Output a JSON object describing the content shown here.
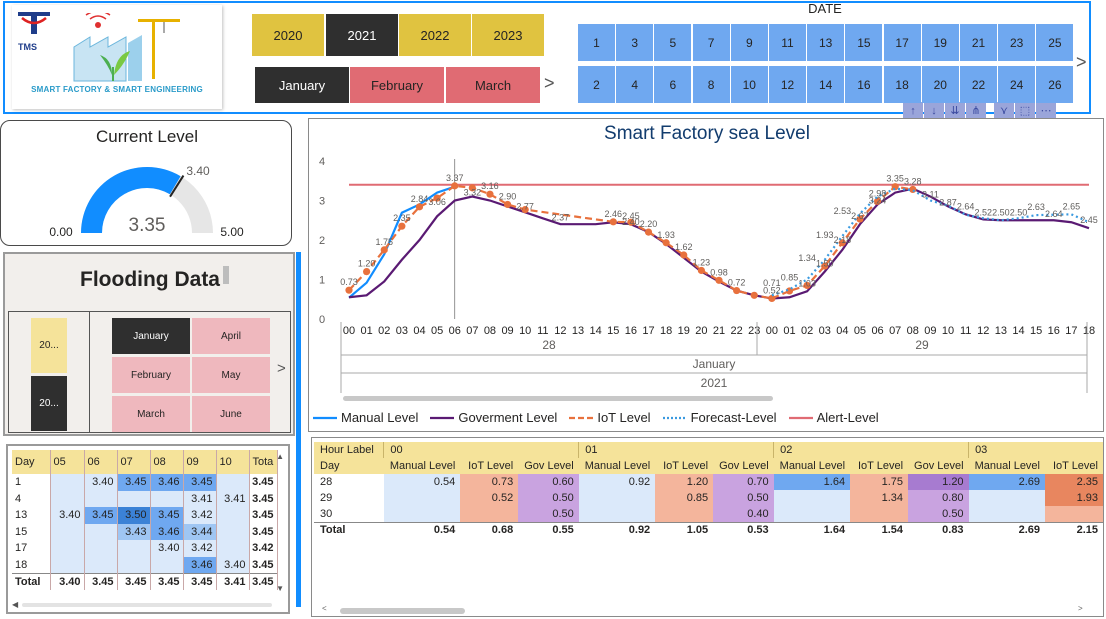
{
  "logo": {
    "tms_text": "TMS",
    "caption": "SMART FACTORY & SMART ENGINEERING"
  },
  "year_slicer": {
    "items": [
      "2020",
      "2021",
      "2022",
      "2023"
    ],
    "selected": "2021"
  },
  "month_slicer": {
    "items": [
      "January",
      "February",
      "March"
    ],
    "selected": "January",
    "next_arrow": ">"
  },
  "date_slicer": {
    "title": "DATE",
    "row1": [
      "1",
      "3",
      "5",
      "7",
      "9",
      "11",
      "13",
      "15",
      "17",
      "19",
      "21",
      "23",
      "25"
    ],
    "row2": [
      "2",
      "4",
      "6",
      "8",
      "10",
      "12",
      "14",
      "16",
      "18",
      "20",
      "22",
      "24",
      "26"
    ],
    "next_arrow": ">"
  },
  "toolbar_icons": [
    "drill-up-icon",
    "drill-down-icon",
    "expand-next-level-icon",
    "expand-all-icon",
    "filter-icon",
    "focus-mode-icon",
    "more-options-icon"
  ],
  "gauge": {
    "title": "Current Level",
    "value": 3.35,
    "value_text": "3.35",
    "min_text": "0.00",
    "max_text": "5.00",
    "target_text": "3.40",
    "min": 0,
    "max": 5,
    "target": 3.4,
    "colors": {
      "fill": "#118dff",
      "track": "#e6e6e6",
      "target": "#252423"
    }
  },
  "flooding": {
    "title": "Flooding Data",
    "years": [
      "20...",
      "20..."
    ],
    "months": [
      "January",
      "April",
      "February",
      "May",
      "March",
      "June"
    ],
    "selected_month": "January",
    "next_arrow": ">"
  },
  "flood_matrix": {
    "headers": [
      "Day",
      "05",
      "06",
      "07",
      "08",
      "09",
      "10",
      "Tota"
    ],
    "rows": [
      [
        "1",
        "",
        "3.40",
        "3.45",
        "3.46",
        "3.45",
        "",
        "3.45"
      ],
      [
        "4",
        "",
        "",
        "",
        "",
        "3.41",
        "3.41",
        "3.45"
      ],
      [
        "13",
        "3.40",
        "3.45",
        "3.50",
        "3.45",
        "3.42",
        "",
        "3.45"
      ],
      [
        "15",
        "",
        "",
        "3.43",
        "3.46",
        "3.44",
        "",
        "3.45"
      ],
      [
        "17",
        "",
        "",
        "",
        "3.40",
        "3.42",
        "",
        "3.42"
      ],
      [
        "18",
        "",
        "",
        "",
        "",
        "3.46",
        "3.40",
        "3.45"
      ]
    ],
    "total": [
      "Total",
      "3.40",
      "3.45",
      "3.45",
      "3.45",
      "3.45",
      "3.41",
      "3.45"
    ]
  },
  "chart_data": {
    "type": "line",
    "title": "Smart Factory sea Level",
    "xlabel": "",
    "ylabel": "",
    "ylim": [
      0,
      4
    ],
    "y_ticks": [
      "0",
      "1",
      "2",
      "3",
      "4"
    ],
    "x_hours": [
      "00",
      "01",
      "02",
      "03",
      "04",
      "05",
      "06",
      "07",
      "08",
      "09",
      "10",
      "11",
      "12",
      "13",
      "14",
      "15",
      "16",
      "17",
      "18",
      "19",
      "20",
      "21",
      "22",
      "23",
      "00",
      "01",
      "02",
      "03",
      "04",
      "05",
      "06",
      "07",
      "08",
      "09",
      "10",
      "11",
      "12",
      "13",
      "14",
      "15",
      "16",
      "17",
      "18"
    ],
    "x_days": [
      "28",
      "29"
    ],
    "x_month": "January",
    "x_year": "2021",
    "alert_level": 3.4,
    "series": [
      {
        "name": "Manual Level",
        "color": "#118dff",
        "style": "solid",
        "points": [
          [
            0,
            0.54
          ],
          [
            1,
            0.92
          ],
          [
            2,
            1.64
          ],
          [
            3,
            2.69
          ],
          [
            4,
            2.9
          ],
          [
            5,
            3.2
          ],
          [
            6,
            3.35
          ]
        ]
      },
      {
        "name": "Goverment Level",
        "color": "#5a1a73",
        "style": "solid",
        "points": [
          [
            0,
            0.55
          ],
          [
            1,
            0.6
          ],
          [
            2,
            0.95
          ],
          [
            3,
            1.5
          ],
          [
            4,
            2.0
          ],
          [
            5,
            2.6
          ],
          [
            6,
            3.0
          ],
          [
            7,
            3.1
          ],
          [
            8,
            3.0
          ],
          [
            9,
            2.85
          ],
          [
            10,
            2.7
          ],
          [
            11,
            2.55
          ],
          [
            12,
            2.4
          ],
          [
            13,
            2.4
          ],
          [
            14,
            2.4
          ],
          [
            15,
            2.45
          ],
          [
            16,
            2.4
          ],
          [
            17,
            2.2
          ],
          [
            18,
            1.9
          ],
          [
            19,
            1.55
          ],
          [
            20,
            1.2
          ],
          [
            21,
            0.95
          ],
          [
            22,
            0.72
          ],
          [
            23,
            0.6
          ],
          [
            24,
            0.52
          ],
          [
            25,
            0.55
          ],
          [
            26,
            0.7
          ],
          [
            27,
            1.2
          ],
          [
            28,
            1.75
          ],
          [
            29,
            2.4
          ],
          [
            30,
            2.9
          ],
          [
            31,
            3.2
          ],
          [
            32,
            3.3
          ],
          [
            33,
            3.1
          ],
          [
            34,
            2.85
          ],
          [
            35,
            2.65
          ],
          [
            36,
            2.52
          ],
          [
            37,
            2.5
          ],
          [
            38,
            2.5
          ],
          [
            39,
            2.5
          ],
          [
            40,
            2.5
          ],
          [
            41,
            2.45
          ],
          [
            42,
            2.3
          ]
        ]
      },
      {
        "name": "IoT Level",
        "color": "#e8713d",
        "style": "dashed",
        "points": [
          [
            0,
            0.73
          ],
          [
            1,
            1.2
          ],
          [
            2,
            1.75
          ],
          [
            3,
            2.35
          ],
          [
            4,
            2.84
          ],
          [
            5,
            3.06
          ],
          [
            6,
            3.37
          ],
          [
            7,
            3.32
          ],
          [
            8,
            3.16
          ],
          [
            9,
            2.9
          ],
          [
            10,
            2.77
          ],
          [
            15,
            2.46
          ],
          [
            16,
            2.45
          ],
          [
            17,
            2.2
          ],
          [
            18,
            1.93
          ],
          [
            19,
            1.62
          ],
          [
            20,
            1.23
          ],
          [
            21,
            0.98
          ],
          [
            22,
            0.72
          ],
          [
            23,
            0.6
          ],
          [
            24,
            0.52
          ],
          [
            25,
            0.71
          ],
          [
            26,
            0.85
          ],
          [
            27,
            1.34
          ],
          [
            28,
            1.93
          ],
          [
            29,
            2.53
          ],
          [
            30,
            2.98
          ],
          [
            31,
            3.35
          ],
          [
            32,
            3.28
          ]
        ]
      },
      {
        "name": "Forecast-Level",
        "color": "#3a9ae0",
        "style": "dotted",
        "points": [
          [
            24,
            0.6
          ],
          [
            25,
            0.75
          ],
          [
            26,
            1.0
          ],
          [
            27,
            1.5
          ],
          [
            28,
            2.1
          ],
          [
            29,
            2.67
          ],
          [
            30,
            3.1
          ],
          [
            31,
            3.3
          ],
          [
            32,
            3.26
          ],
          [
            33,
            3.0
          ],
          [
            34,
            2.87
          ],
          [
            35,
            2.64
          ],
          [
            36,
            2.55
          ],
          [
            37,
            2.5
          ],
          [
            38,
            2.55
          ],
          [
            39,
            2.63
          ],
          [
            40,
            2.64
          ],
          [
            41,
            2.65
          ],
          [
            42,
            2.45
          ]
        ]
      },
      {
        "name": "Alert-Level",
        "color": "#e06b73",
        "style": "solid"
      }
    ],
    "data_labels": [
      {
        "x": 0,
        "y": 0.73,
        "t": "0.73"
      },
      {
        "x": 1,
        "y": 1.2,
        "t": "1.20"
      },
      {
        "x": 2,
        "y": 1.75,
        "t": "1.75"
      },
      {
        "x": 3,
        "y": 2.35,
        "t": "2.35"
      },
      {
        "x": 4,
        "y": 2.84,
        "t": "2.84"
      },
      {
        "x": 5,
        "y": 2.76,
        "t": "3.06"
      },
      {
        "x": 6,
        "y": 3.37,
        "t": "3.37"
      },
      {
        "x": 7,
        "y": 3.0,
        "t": "3.32"
      },
      {
        "x": 8,
        "y": 3.16,
        "t": "3.16"
      },
      {
        "x": 9,
        "y": 2.9,
        "t": "2.90"
      },
      {
        "x": 10,
        "y": 2.65,
        "t": "2.77"
      },
      {
        "x": 12,
        "y": 2.37,
        "t": "2.37"
      },
      {
        "x": 15,
        "y": 2.46,
        "t": "2.46"
      },
      {
        "x": 16,
        "y": 2.4,
        "t": "2.45"
      },
      {
        "x": 17,
        "y": 2.2,
        "t": "2.20"
      },
      {
        "x": 16,
        "y": 2.25,
        "t": "2.40"
      },
      {
        "x": 18,
        "y": 1.93,
        "t": "1.93"
      },
      {
        "x": 19,
        "y": 1.62,
        "t": "1.62"
      },
      {
        "x": 20,
        "y": 1.23,
        "t": "1.23"
      },
      {
        "x": 21,
        "y": 0.98,
        "t": "0.98"
      },
      {
        "x": 22,
        "y": 0.72,
        "t": "0.72"
      },
      {
        "x": 24,
        "y": 0.71,
        "t": "0.71"
      },
      {
        "x": 24,
        "y": 0.52,
        "t": "0.52"
      },
      {
        "x": 25,
        "y": 0.85,
        "t": "0.85"
      },
      {
        "x": 26,
        "y": 1.34,
        "t": "1.34"
      },
      {
        "x": 26,
        "y": 0.7,
        "t": "1.03"
      },
      {
        "x": 27,
        "y": 1.93,
        "t": "1.93"
      },
      {
        "x": 27,
        "y": 1.2,
        "t": "1.50"
      },
      {
        "x": 28,
        "y": 2.53,
        "t": "2.53"
      },
      {
        "x": 28,
        "y": 1.8,
        "t": "2.18"
      },
      {
        "x": 30,
        "y": 2.98,
        "t": "2.98"
      },
      {
        "x": 29,
        "y": 2.4,
        "t": "2.67"
      },
      {
        "x": 30,
        "y": 2.8,
        "t": "3.24"
      },
      {
        "x": 31,
        "y": 3.35,
        "t": "3.35"
      },
      {
        "x": 32,
        "y": 3.28,
        "t": "3.28"
      },
      {
        "x": 33,
        "y": 2.95,
        "t": "3.11"
      },
      {
        "x": 34,
        "y": 2.75,
        "t": "2.87"
      },
      {
        "x": 35,
        "y": 2.64,
        "t": "2.64"
      },
      {
        "x": 36,
        "y": 2.5,
        "t": "2.52"
      },
      {
        "x": 37,
        "y": 2.5,
        "t": "2.50"
      },
      {
        "x": 38,
        "y": 2.5,
        "t": "2.50"
      },
      {
        "x": 39,
        "y": 2.63,
        "t": "2.63"
      },
      {
        "x": 40,
        "y": 2.45,
        "t": "2.64"
      },
      {
        "x": 41,
        "y": 2.65,
        "t": "2.65"
      },
      {
        "x": 42,
        "y": 2.3,
        "t": "2.45"
      }
    ]
  },
  "legend": [
    {
      "name": "Manual Level",
      "color": "#118dff",
      "style": "solid"
    },
    {
      "name": "Goverment Level",
      "color": "#5a1a73",
      "style": "solid"
    },
    {
      "name": "IoT Level",
      "color": "#e8713d",
      "style": "dashed"
    },
    {
      "name": "Forecast-Level",
      "color": "#3a9ae0",
      "style": "dotted"
    },
    {
      "name": "Alert-Level",
      "color": "#e06b73",
      "style": "solid"
    }
  ],
  "hour_matrix": {
    "hour_label": "Hour Label",
    "day_label": "Day",
    "hours": [
      "00",
      "01",
      "02",
      "03"
    ],
    "measures": [
      "Manual Level",
      "IoT Level",
      "Gov Level"
    ],
    "extra_measure": "Manual Level",
    "rows": [
      {
        "day": "28",
        "vals": [
          "0.54",
          "0.73",
          "0.60",
          "0.92",
          "1.20",
          "0.70",
          "1.64",
          "1.75",
          "1.20",
          "2.69",
          "2.35"
        ]
      },
      {
        "day": "29",
        "vals": [
          "",
          "0.52",
          "0.50",
          "",
          "0.85",
          "0.50",
          "",
          "1.34",
          "0.80",
          "",
          "1.93"
        ]
      },
      {
        "day": "30",
        "vals": [
          "",
          "",
          "0.50",
          "",
          "",
          "0.40",
          "",
          "",
          "0.50",
          "",
          ""
        ]
      }
    ],
    "total": {
      "day": "Total",
      "vals": [
        "0.54",
        "0.68",
        "0.55",
        "0.92",
        "1.05",
        "0.53",
        "1.64",
        "1.54",
        "0.83",
        "2.69",
        "2.15"
      ]
    }
  }
}
